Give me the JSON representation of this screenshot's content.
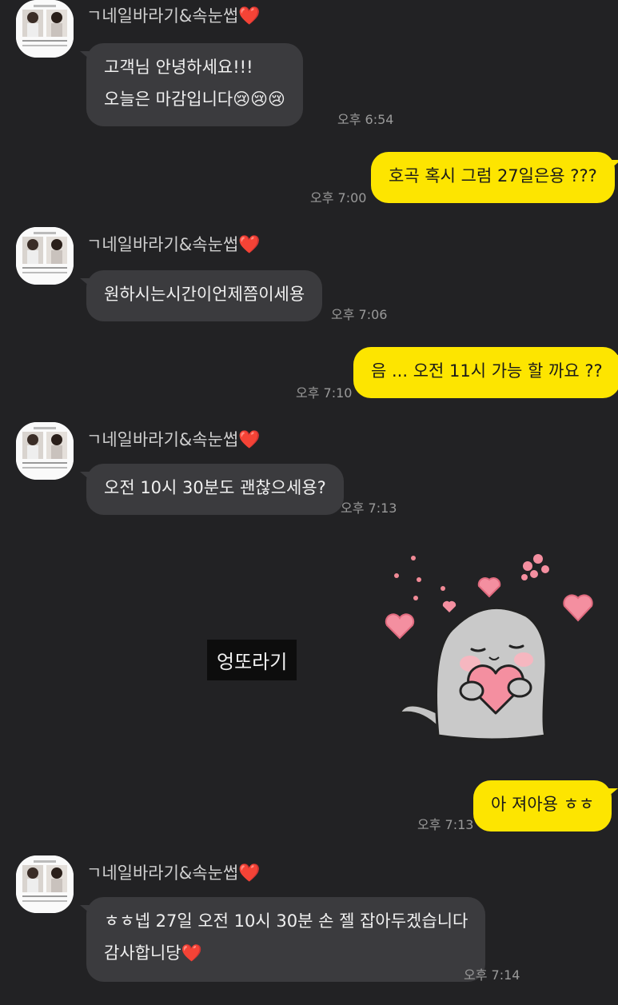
{
  "contact": {
    "name": "ㄱ네일바라기&속눈썹",
    "heart": "❤️",
    "avatar_icon": "profile-photo"
  },
  "messages": [
    {
      "dir": "in",
      "lines": [
        "고객님 안녕하세요!!!",
        "오늘은 마감입니다😢😢😢"
      ],
      "time": "오후 6:54"
    },
    {
      "dir": "out",
      "lines": [
        "호곡 혹시 그럼 27일은용 ???"
      ],
      "time": "오후 7:00"
    },
    {
      "dir": "in",
      "lines": [
        "원하시는시간이언제쯤이세용"
      ],
      "time": "오후 7:06"
    },
    {
      "dir": "out",
      "lines": [
        "음 ... 오전 11시 가능 할 까요 ??"
      ],
      "time": "오후 7:10"
    },
    {
      "dir": "in",
      "lines": [
        "오전 10시 30분도 괜찮으세용?"
      ],
      "time": "오후 7:13"
    },
    {
      "dir": "out",
      "lines": [
        "아 져아용 ㅎㅎ"
      ],
      "time": "오후 7:13"
    },
    {
      "dir": "in",
      "lines": [
        "ㅎㅎ넵 27일 오전 10시 30분 손 젤 잡아두겠습니다",
        "감사합니당❤️"
      ],
      "time": "오후 7:14"
    }
  ],
  "sticker": {
    "caption": "엉또라기",
    "icon": "seal-hugging-heart-sticker"
  },
  "colors": {
    "background": "#222224",
    "incoming_bubble": "#3b3b3e",
    "outgoing_bubble": "#fde500",
    "heart": "#e8272f"
  }
}
